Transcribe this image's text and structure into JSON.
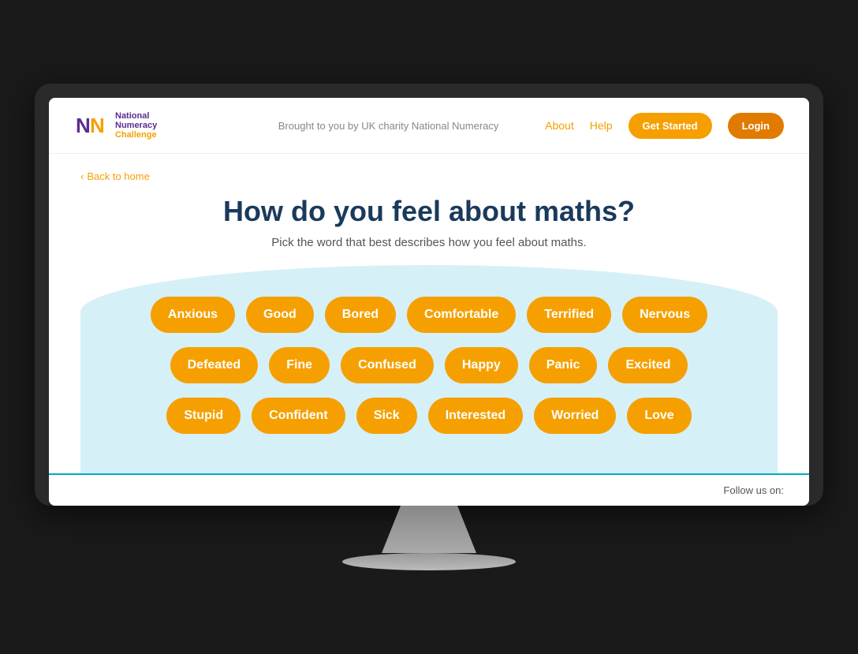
{
  "header": {
    "logo_national": "National",
    "logo_numeracy": "Numeracy",
    "logo_challenge": "Challenge",
    "tagline": "Brought to you by UK charity National Numeracy",
    "nav": {
      "about": "About",
      "help": "Help",
      "get_started": "Get Started",
      "login": "Login"
    }
  },
  "breadcrumb": {
    "back": "Back to home"
  },
  "main": {
    "title": "How do you feel about maths?",
    "subtitle": "Pick the word that best describes how you feel about maths.",
    "emotions_row1": [
      "Anxious",
      "Good",
      "Bored",
      "Comfortable",
      "Terrified",
      "Nervous"
    ],
    "emotions_row2": [
      "Defeated",
      "Fine",
      "Confused",
      "Happy",
      "Panic",
      "Excited"
    ],
    "emotions_row3": [
      "Stupid",
      "Confident",
      "Sick",
      "Interested",
      "Worried",
      "Love"
    ]
  },
  "footer": {
    "follow_text": "Follow us on:"
  }
}
